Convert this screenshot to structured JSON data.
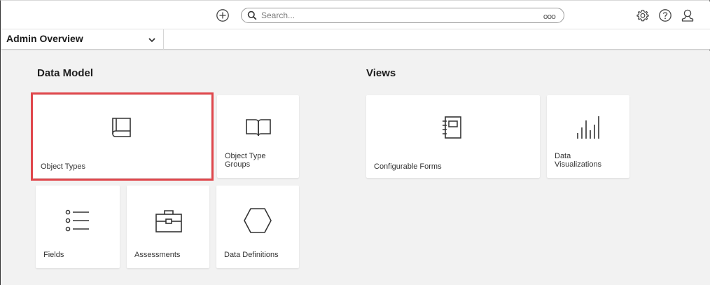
{
  "header": {
    "search": {
      "placeholder": "Search...",
      "more_label": "ooo"
    },
    "icons": [
      "add-circle-icon",
      "search-icon",
      "gear-icon",
      "help-icon",
      "user-icon"
    ]
  },
  "subbar": {
    "view_label": "Admin Overview"
  },
  "sections": {
    "data_model": {
      "title": "Data Model",
      "tiles": [
        {
          "label": "Object Types",
          "icon": "book-icon",
          "selected": true
        },
        {
          "label": "Object Type\nGroups",
          "icon": "open-book-icon"
        },
        {
          "label": "Fields",
          "icon": "list-icon"
        },
        {
          "label": "Assessments",
          "icon": "briefcase-icon"
        },
        {
          "label": "Data Definitions",
          "icon": "hexagon-icon"
        }
      ]
    },
    "views": {
      "title": "Views",
      "tiles": [
        {
          "label": "Configurable Forms",
          "icon": "notebook-icon"
        },
        {
          "label": "Data\nVisualizations",
          "icon": "bar-chart-icon"
        }
      ]
    }
  },
  "colors": {
    "highlight": "#e0474c",
    "background": "#f2f2f2",
    "tile": "#ffffff"
  }
}
